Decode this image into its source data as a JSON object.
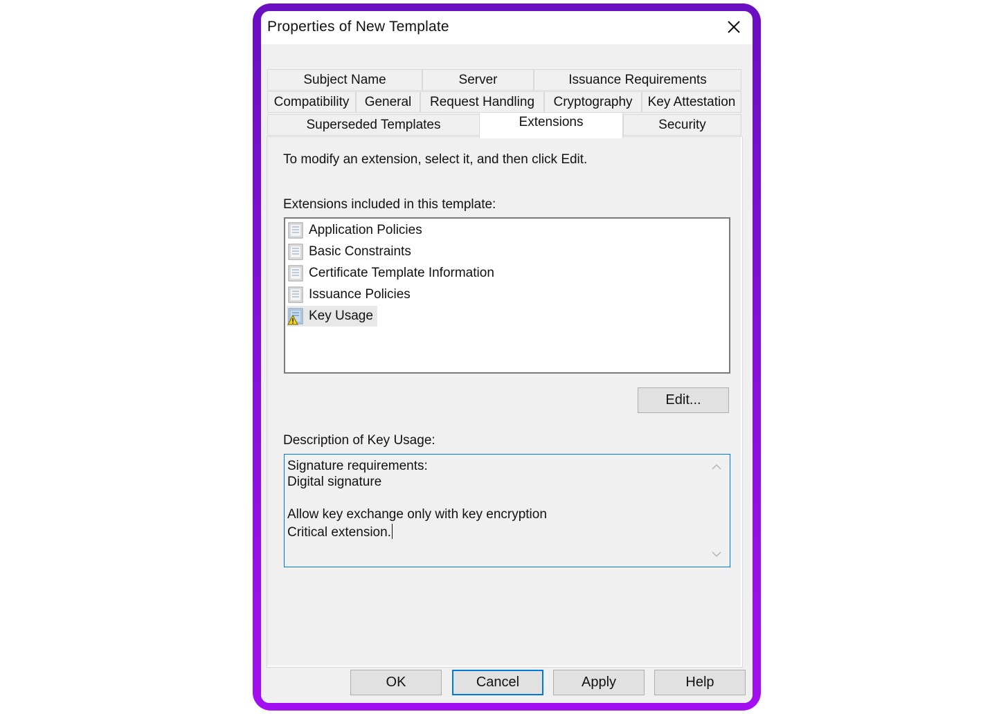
{
  "window": {
    "title": "Properties of New Template"
  },
  "tabs": {
    "row1": [
      "Subject Name",
      "Server",
      "Issuance Requirements"
    ],
    "row2": [
      "Compatibility",
      "General",
      "Request Handling",
      "Cryptography",
      "Key Attestation"
    ],
    "row3": [
      "Superseded Templates",
      "Extensions",
      "Security"
    ],
    "active": "Extensions"
  },
  "panel": {
    "instruction": "To modify an extension, select it, and then click Edit.",
    "list_label": "Extensions included in this template:",
    "extensions": [
      {
        "label": "Application Policies",
        "icon": "extension-icon"
      },
      {
        "label": "Basic Constraints",
        "icon": "extension-icon"
      },
      {
        "label": "Certificate Template Information",
        "icon": "extension-icon"
      },
      {
        "label": "Issuance Policies",
        "icon": "extension-icon"
      },
      {
        "label": "Key Usage",
        "icon": "extension-warning-icon",
        "selected": true
      }
    ],
    "edit_button": "Edit...",
    "description_label": "Description of Key Usage:",
    "description_lines": [
      "Signature requirements:",
      "Digital signature",
      "",
      "Allow key exchange only with key encryption",
      "Critical extension."
    ]
  },
  "buttons": {
    "ok": "OK",
    "cancel": "Cancel",
    "apply": "Apply",
    "help": "Help"
  },
  "colors": {
    "frame_gradient_top": "#6a0fc2",
    "frame_gradient_bottom": "#a30ff0",
    "focus_blue": "#0078d7"
  }
}
